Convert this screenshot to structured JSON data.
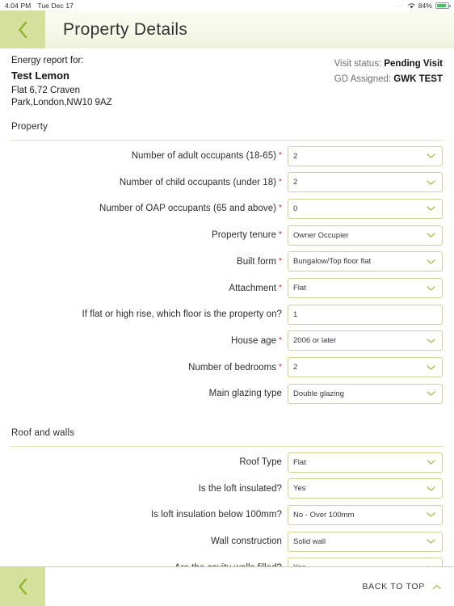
{
  "statusbar": {
    "time": "4:04 PM",
    "date": "Tue Dec 17",
    "dots": "....",
    "battery_percent": "84%",
    "wifi_icon": "wifi-icon",
    "battery_icon": "battery-icon"
  },
  "header": {
    "title": "Property Details",
    "back_icon": "chevron-left-icon"
  },
  "report": {
    "heading": "Energy report for:",
    "customer_name": "Test Lemon",
    "address": "Flat 6,72 Craven Park,London,NW10 9AZ",
    "visit_status_label": "Visit status:",
    "visit_status_value": "Pending Visit",
    "gd_assigned_label": "GD Assigned:",
    "gd_assigned_value": "GWK TEST"
  },
  "sections": [
    {
      "title": "Property",
      "fields": [
        {
          "label": "Number of adult occupants (18-65)",
          "required": true,
          "value": "2",
          "type": "select"
        },
        {
          "label": "Number of child occupants (under 18)",
          "required": true,
          "value": "2",
          "type": "select"
        },
        {
          "label": "Number of OAP occupants (65 and above)",
          "required": true,
          "value": "0",
          "type": "select"
        },
        {
          "label": "Property tenure",
          "required": true,
          "value": "Owner Occupier",
          "type": "select"
        },
        {
          "label": "Built form",
          "required": true,
          "value": "Bungalow/Top floor flat",
          "type": "select"
        },
        {
          "label": "Attachment",
          "required": true,
          "value": "Flat",
          "type": "select"
        },
        {
          "label": "If flat or high rise, which floor is the property on?",
          "required": false,
          "value": "1",
          "type": "text"
        },
        {
          "label": "House age",
          "required": true,
          "value": "2006 or later",
          "type": "select"
        },
        {
          "label": "Number of bedrooms",
          "required": true,
          "value": "2",
          "type": "select"
        },
        {
          "label": "Main glazing type",
          "required": false,
          "value": "Double glazing",
          "type": "select"
        }
      ]
    },
    {
      "title": "Roof and walls",
      "fields": [
        {
          "label": "Roof Type",
          "required": false,
          "value": "Flat",
          "type": "select"
        },
        {
          "label": "Is the loft insulated?",
          "required": false,
          "value": "Yes",
          "type": "select"
        },
        {
          "label": "Is loft insulation below 100mm?",
          "required": false,
          "value": "No - Over 100mm",
          "type": "select"
        },
        {
          "label": "Wall construction",
          "required": false,
          "value": "Solid wall",
          "type": "select"
        },
        {
          "label": "Are the cavity walls filled?",
          "required": false,
          "value": "Yes",
          "type": "select"
        }
      ]
    }
  ],
  "footer": {
    "back_icon": "chevron-left-icon",
    "back_to_top_label": "BACK TO TOP",
    "back_to_top_icon": "chevron-up-icon"
  },
  "colors": {
    "accent_green": "#8db32a",
    "pale_green": "#d5e09d",
    "field_border": "#c9d58e",
    "required_red": "#e02020",
    "battery_green": "#3cc85a"
  }
}
